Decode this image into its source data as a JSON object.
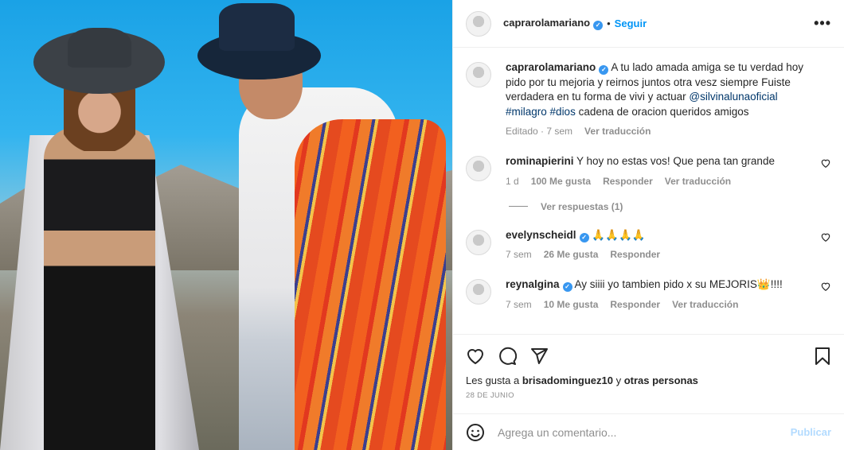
{
  "post": {
    "author": "caprarolamariano",
    "follow_label": "Seguir",
    "dot": "•",
    "more": "•••",
    "image_alt": "Pareja con sombreros en paisaje de montaña"
  },
  "caption": {
    "author": "caprarolamariano",
    "text": "A tu lado amada amiga se tu verdad hoy pido por tu mejoria y reirnos juntos otra vesz siempre Fuiste verdadera en tu forma de vivi y actuar ",
    "mention": "@silvinalunaoficial",
    "hashtag1": "#milagro",
    "hashtag2": "#dios",
    "tail": " cadena de oracion queridos amigos",
    "edited": "Editado · 7 sem",
    "see_translation": "Ver traducción"
  },
  "comments": [
    {
      "author": "rominapierini",
      "text": "Y hoy no estas vos! Que pena tan grande",
      "time": "1 d",
      "likes": "100 Me gusta",
      "reply": "Responder",
      "translate": "Ver traducción",
      "view_replies": "Ver respuestas (1)"
    },
    {
      "author": "evelynscheidl",
      "text": "🙏🙏🙏🙏",
      "time": "7 sem",
      "likes": "26 Me gusta",
      "reply": "Responder"
    },
    {
      "author": "reynalgina",
      "text": "Ay siiii yo tambien pido x su MEJORIS👑!!!!",
      "time": "7 sem",
      "likes": "10 Me gusta",
      "reply": "Responder",
      "translate": "Ver traducción"
    }
  ],
  "footer": {
    "likes_prefix": "Les gusta a ",
    "likes_user": "brisadominguez10",
    "likes_mid": " y ",
    "likes_others": "otras personas",
    "date": "28 DE JUNIO",
    "comment_placeholder": "Agrega un comentario...",
    "publish": "Publicar"
  },
  "colors": {
    "accent": "#0095f6",
    "verified": "#3897f0",
    "link": "#00376b",
    "muted": "#8e8e8e"
  }
}
